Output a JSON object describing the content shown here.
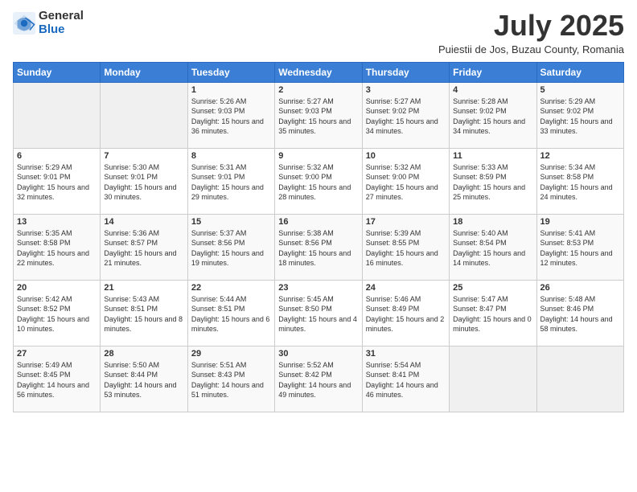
{
  "logo": {
    "general": "General",
    "blue": "Blue"
  },
  "title": "July 2025",
  "location": "Puiestii de Jos, Buzau County, Romania",
  "headers": [
    "Sunday",
    "Monday",
    "Tuesday",
    "Wednesday",
    "Thursday",
    "Friday",
    "Saturday"
  ],
  "weeks": [
    [
      {
        "day": "",
        "info": ""
      },
      {
        "day": "",
        "info": ""
      },
      {
        "day": "1",
        "info": "Sunrise: 5:26 AM\nSunset: 9:03 PM\nDaylight: 15 hours and 36 minutes."
      },
      {
        "day": "2",
        "info": "Sunrise: 5:27 AM\nSunset: 9:03 PM\nDaylight: 15 hours and 35 minutes."
      },
      {
        "day": "3",
        "info": "Sunrise: 5:27 AM\nSunset: 9:02 PM\nDaylight: 15 hours and 34 minutes."
      },
      {
        "day": "4",
        "info": "Sunrise: 5:28 AM\nSunset: 9:02 PM\nDaylight: 15 hours and 34 minutes."
      },
      {
        "day": "5",
        "info": "Sunrise: 5:29 AM\nSunset: 9:02 PM\nDaylight: 15 hours and 33 minutes."
      }
    ],
    [
      {
        "day": "6",
        "info": "Sunrise: 5:29 AM\nSunset: 9:01 PM\nDaylight: 15 hours and 32 minutes."
      },
      {
        "day": "7",
        "info": "Sunrise: 5:30 AM\nSunset: 9:01 PM\nDaylight: 15 hours and 30 minutes."
      },
      {
        "day": "8",
        "info": "Sunrise: 5:31 AM\nSunset: 9:01 PM\nDaylight: 15 hours and 29 minutes."
      },
      {
        "day": "9",
        "info": "Sunrise: 5:32 AM\nSunset: 9:00 PM\nDaylight: 15 hours and 28 minutes."
      },
      {
        "day": "10",
        "info": "Sunrise: 5:32 AM\nSunset: 9:00 PM\nDaylight: 15 hours and 27 minutes."
      },
      {
        "day": "11",
        "info": "Sunrise: 5:33 AM\nSunset: 8:59 PM\nDaylight: 15 hours and 25 minutes."
      },
      {
        "day": "12",
        "info": "Sunrise: 5:34 AM\nSunset: 8:58 PM\nDaylight: 15 hours and 24 minutes."
      }
    ],
    [
      {
        "day": "13",
        "info": "Sunrise: 5:35 AM\nSunset: 8:58 PM\nDaylight: 15 hours and 22 minutes."
      },
      {
        "day": "14",
        "info": "Sunrise: 5:36 AM\nSunset: 8:57 PM\nDaylight: 15 hours and 21 minutes."
      },
      {
        "day": "15",
        "info": "Sunrise: 5:37 AM\nSunset: 8:56 PM\nDaylight: 15 hours and 19 minutes."
      },
      {
        "day": "16",
        "info": "Sunrise: 5:38 AM\nSunset: 8:56 PM\nDaylight: 15 hours and 18 minutes."
      },
      {
        "day": "17",
        "info": "Sunrise: 5:39 AM\nSunset: 8:55 PM\nDaylight: 15 hours and 16 minutes."
      },
      {
        "day": "18",
        "info": "Sunrise: 5:40 AM\nSunset: 8:54 PM\nDaylight: 15 hours and 14 minutes."
      },
      {
        "day": "19",
        "info": "Sunrise: 5:41 AM\nSunset: 8:53 PM\nDaylight: 15 hours and 12 minutes."
      }
    ],
    [
      {
        "day": "20",
        "info": "Sunrise: 5:42 AM\nSunset: 8:52 PM\nDaylight: 15 hours and 10 minutes."
      },
      {
        "day": "21",
        "info": "Sunrise: 5:43 AM\nSunset: 8:51 PM\nDaylight: 15 hours and 8 minutes."
      },
      {
        "day": "22",
        "info": "Sunrise: 5:44 AM\nSunset: 8:51 PM\nDaylight: 15 hours and 6 minutes."
      },
      {
        "day": "23",
        "info": "Sunrise: 5:45 AM\nSunset: 8:50 PM\nDaylight: 15 hours and 4 minutes."
      },
      {
        "day": "24",
        "info": "Sunrise: 5:46 AM\nSunset: 8:49 PM\nDaylight: 15 hours and 2 minutes."
      },
      {
        "day": "25",
        "info": "Sunrise: 5:47 AM\nSunset: 8:47 PM\nDaylight: 15 hours and 0 minutes."
      },
      {
        "day": "26",
        "info": "Sunrise: 5:48 AM\nSunset: 8:46 PM\nDaylight: 14 hours and 58 minutes."
      }
    ],
    [
      {
        "day": "27",
        "info": "Sunrise: 5:49 AM\nSunset: 8:45 PM\nDaylight: 14 hours and 56 minutes."
      },
      {
        "day": "28",
        "info": "Sunrise: 5:50 AM\nSunset: 8:44 PM\nDaylight: 14 hours and 53 minutes."
      },
      {
        "day": "29",
        "info": "Sunrise: 5:51 AM\nSunset: 8:43 PM\nDaylight: 14 hours and 51 minutes."
      },
      {
        "day": "30",
        "info": "Sunrise: 5:52 AM\nSunset: 8:42 PM\nDaylight: 14 hours and 49 minutes."
      },
      {
        "day": "31",
        "info": "Sunrise: 5:54 AM\nSunset: 8:41 PM\nDaylight: 14 hours and 46 minutes."
      },
      {
        "day": "",
        "info": ""
      },
      {
        "day": "",
        "info": ""
      }
    ]
  ]
}
